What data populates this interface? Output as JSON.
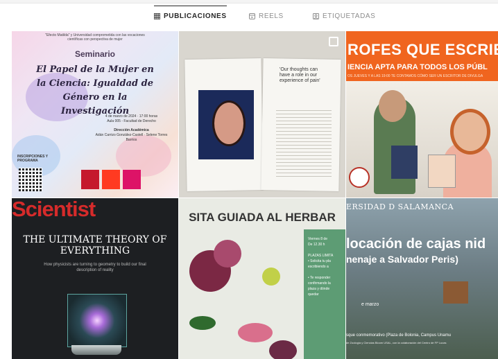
{
  "tabs": [
    {
      "label": "PUBLICACIONES",
      "icon": "grid-icon",
      "active": true
    },
    {
      "label": "REELS",
      "icon": "reels-icon",
      "active": false
    },
    {
      "label": "ETIQUETADAS",
      "icon": "tagged-icon",
      "active": false
    }
  ],
  "posts": {
    "p1": {
      "header": "\"Efecto Matilda\" y Universidad comprometida con las vocaciones científicas con perspectiva de mujer",
      "kicker": "Seminario",
      "title": "El Papel de la Mujer en la Ciencia: Igualdad de Género en la Investigación",
      "date": "4 de marzo de 2024 · 17:00 horas",
      "place": "Aula 005 - Facultad de Derecho",
      "direction": "Dirección Académica",
      "names": "Adán Carrizo González-Castell · Selene Torres Barrios",
      "inscriptions": "INSCRIPCIONES Y PROGRAMA"
    },
    "p2": {
      "quote": "'Our thoughts can have a role in our experience of pain'"
    },
    "p3": {
      "headline": "ROFES QUE ESCRIB",
      "subheadline": "IENCIA APTA PARA TODOS LOS PÚBL",
      "detail": "OS JUEVES Y A LAS 19:00 TE CONTAMOS CÓMO SER UN ESCRITOR DE DIVULGA"
    },
    "p4": {
      "masthead": "Scientist",
      "cover_title": "THE ULTIMATE THEORY OF EVERYTHING",
      "cover_sub": "How physicists are turning to geometry to build our final description of reality"
    },
    "p5": {
      "banner": "SITA GUIADA AL HERBAR",
      "panel_lines": [
        "Viernes 8 de",
        "De 12.30 h",
        "PLAZAS LIMITA",
        "• Solicita tu pla",
        "escribiendo a",
        "• Te responder",
        "confirmando la",
        "plaza y dónde",
        "quedar"
      ]
    },
    "p6": {
      "university": "ERSIDAD D SALAMANCA",
      "headline": "locación de cajas nid",
      "subheadline": "nenaje a Salvador Peris)",
      "date": "e marzo",
      "place": "sque conmemorativo (Plaza de Bolonia, Campus Unamu",
      "small": "de Zoología y Ciencias Bloom USAL, con la colaboración del Centro de FP Lucas"
    }
  },
  "colors": {
    "active_tab": "#262626",
    "inactive_tab": "#8e8e8e",
    "orange_post": "#f0651f",
    "scientist_red": "#d62b2b"
  }
}
